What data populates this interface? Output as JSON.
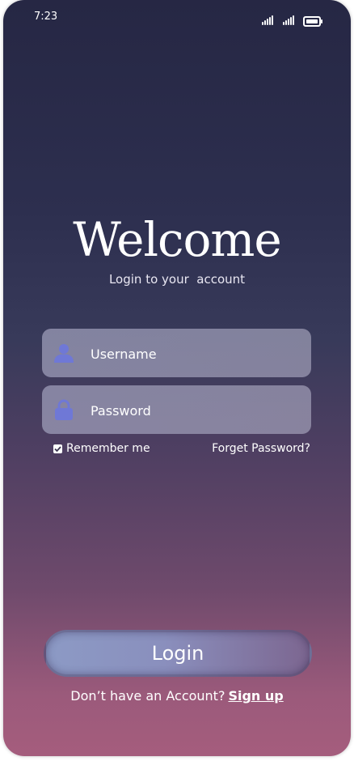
{
  "status_bar": {
    "time": "7:23",
    "icons": [
      "signal-icon",
      "signal-icon",
      "battery-icon"
    ]
  },
  "header": {
    "title": "Welcome",
    "subtitle": "Login to your  account"
  },
  "form": {
    "username": {
      "placeholder": "Username",
      "value": "",
      "icon": "user-icon"
    },
    "password": {
      "placeholder": "Password",
      "value": "",
      "icon": "lock-icon"
    },
    "remember_label": "Remember me",
    "remember_checked": true,
    "forget_label": "Forget Password?"
  },
  "actions": {
    "login_label": "Login",
    "signup_prompt": "Don’t have an Account?",
    "signup_label": "Sign up"
  },
  "colors": {
    "background_top": "#262744",
    "background_bottom": "#a55d7d",
    "icon_accent": "#6f78d6",
    "text": "#ffffff"
  }
}
